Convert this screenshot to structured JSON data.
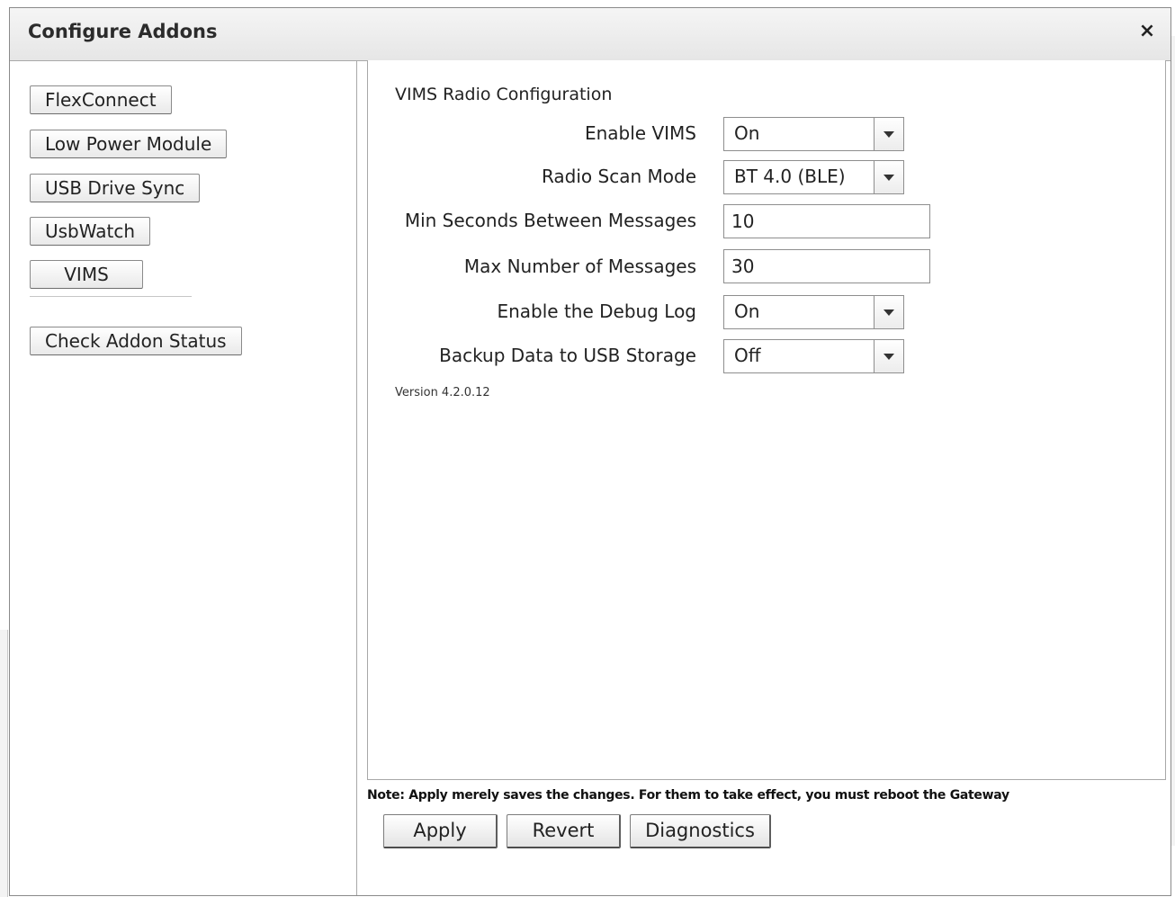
{
  "dialog": {
    "title": "Configure Addons",
    "close_label": "×"
  },
  "sidebar": {
    "items": [
      {
        "label": "FlexConnect"
      },
      {
        "label": "Low Power Module"
      },
      {
        "label": "USB Drive Sync"
      },
      {
        "label": "UsbWatch"
      },
      {
        "label": "VIMS"
      }
    ],
    "status_button": "Check Addon Status"
  },
  "content": {
    "section_title": "VIMS Radio Configuration",
    "fields": {
      "enable_vims": {
        "label": "Enable VIMS",
        "value": "On"
      },
      "radio_scan_mode": {
        "label": "Radio Scan Mode",
        "value": "BT 4.0 (BLE)"
      },
      "min_seconds": {
        "label": "Min Seconds Between Messages",
        "value": "10"
      },
      "max_messages": {
        "label": "Max Number of Messages",
        "value": "30"
      },
      "debug_log": {
        "label": "Enable the Debug Log",
        "value": "On"
      },
      "backup_usb": {
        "label": "Backup Data to USB Storage",
        "value": "Off"
      }
    },
    "version": "Version 4.2.0.12"
  },
  "footer": {
    "note": "Note: Apply merely saves the changes. For them to take effect, you must reboot the Gateway",
    "apply": "Apply",
    "revert": "Revert",
    "diagnostics": "Diagnostics"
  }
}
